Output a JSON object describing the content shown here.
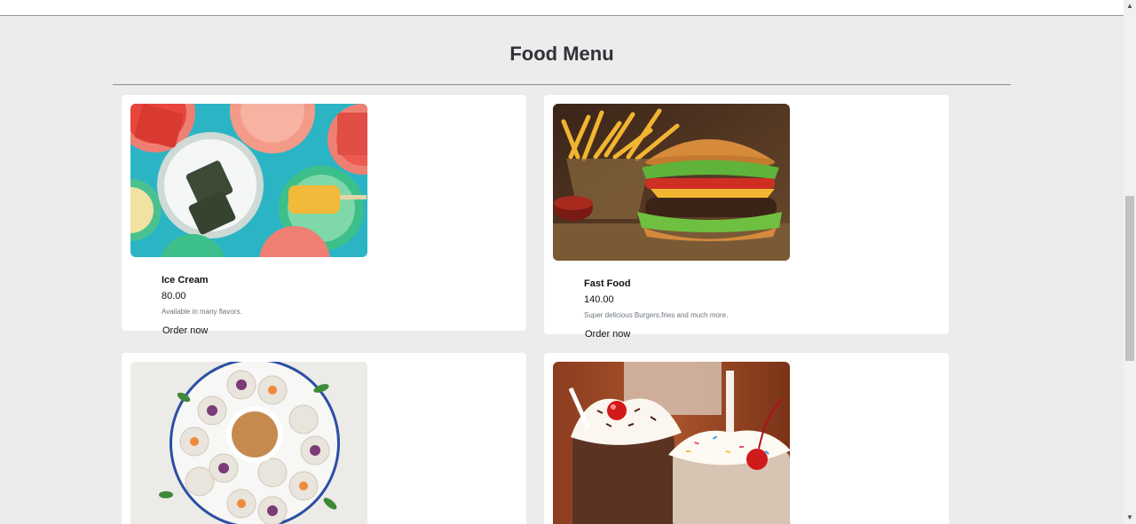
{
  "page": {
    "title": "Food Menu"
  },
  "menu": {
    "items": [
      {
        "name": "Ice Cream",
        "price": "80.00",
        "description": "Available in many flavors.",
        "button": "Order now",
        "image": "ice-cream-photo"
      },
      {
        "name": "Fast Food",
        "price": "140.00",
        "description": "Super delicious Burgers,fries and much more.",
        "button": "Order now",
        "image": "burger-fries-photo"
      },
      {
        "image": "spring-rolls-photo"
      },
      {
        "image": "milkshake-photo"
      }
    ]
  },
  "colors": {
    "background": "#ececec",
    "card": "#ffffff",
    "title": "#2f3237",
    "description": "#6c757d"
  }
}
